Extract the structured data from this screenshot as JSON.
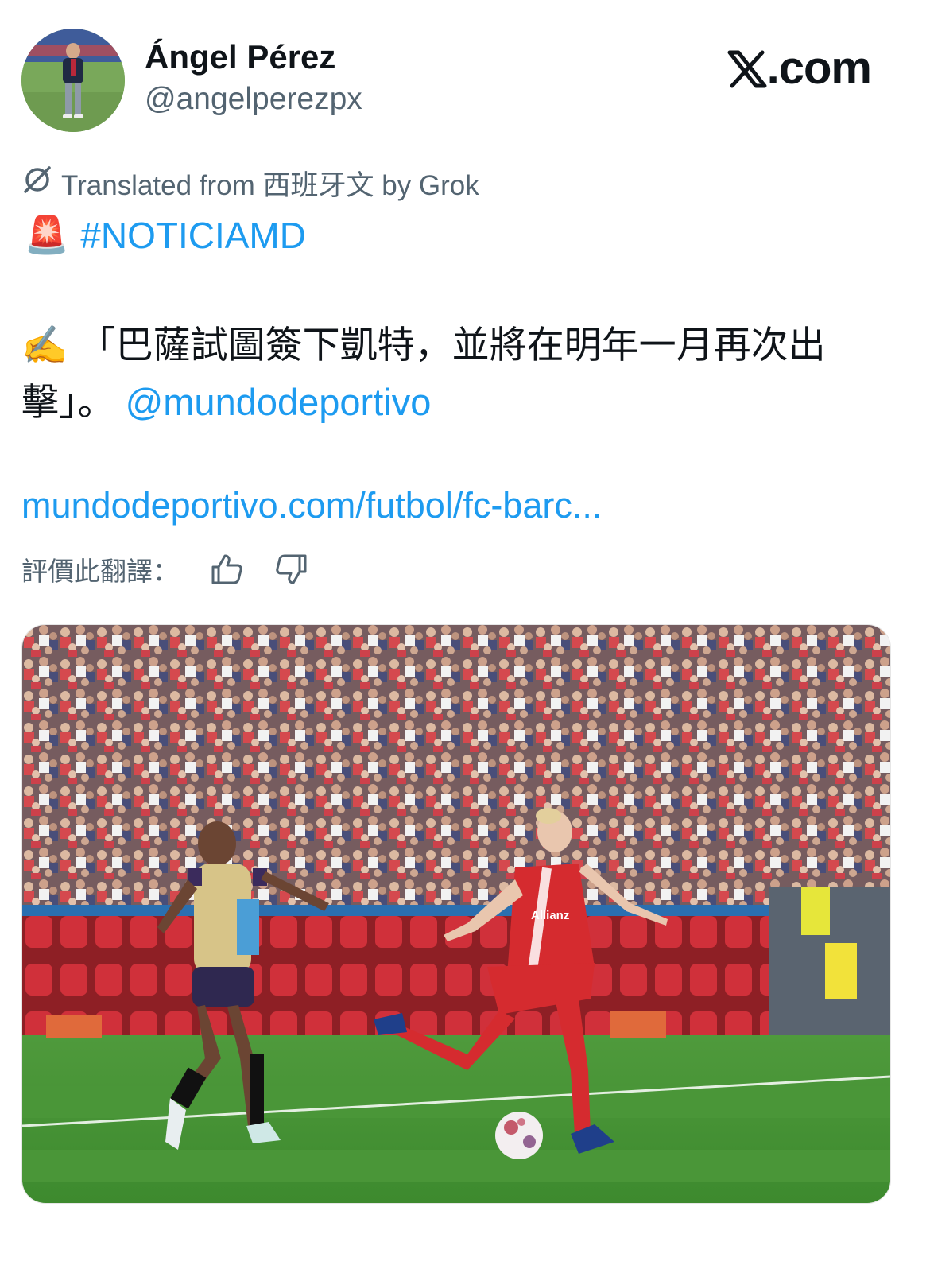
{
  "author": {
    "name": "Ángel Pérez",
    "handle": "@angelperezpx"
  },
  "brand": {
    "label": ".com"
  },
  "translation": {
    "note": "Translated from 西班牙文 by Grok"
  },
  "tweet": {
    "emoji_siren": "🚨",
    "hashtag": "#NOTICIAMD",
    "emoji_writing": "✍️",
    "quote_text": "「巴薩試圖簽下凱特，並將在明年一月再次出擊」。",
    "mention": "@mundodeportivo",
    "url": "mundodeportivo.com/futbol/fc-barc..."
  },
  "rate": {
    "label": "評價此翻譯：",
    "up_icon": "thumbs-up-icon",
    "down_icon": "thumbs-down-icon"
  },
  "colors": {
    "link": "#1d9bf0",
    "secondary_text": "#536471",
    "primary_text": "#0f1419"
  }
}
